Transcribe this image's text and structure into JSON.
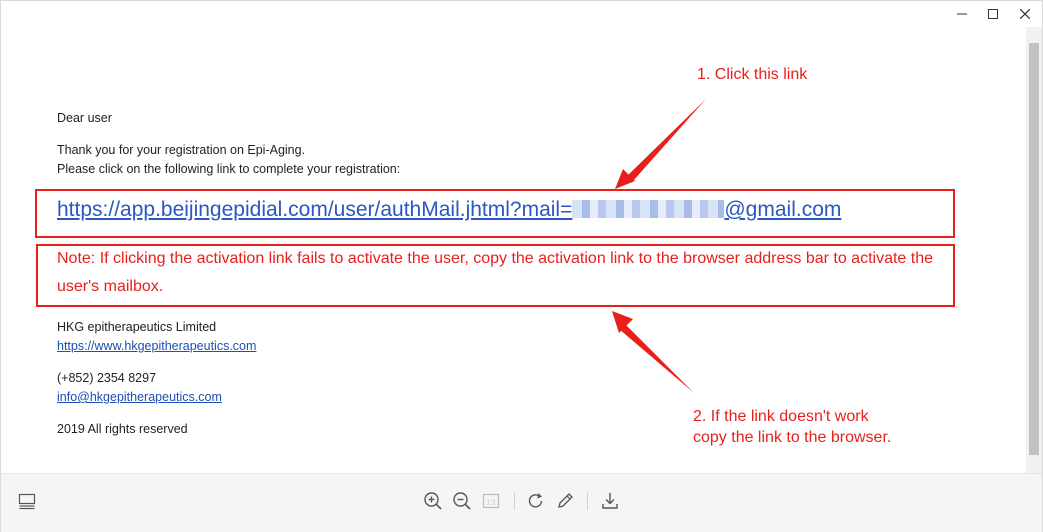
{
  "window": {
    "controls": [
      "minimize",
      "maximize",
      "close"
    ]
  },
  "email": {
    "greeting": "Dear user",
    "thanks": "Thank you for your registration on Epi-Aging.",
    "instruction": "Please click on the following link to complete your registration:",
    "activation_link_prefix": "https://app.beijingepidial.com/user/authMail.jhtml?mail=",
    "activation_link_suffix": "@gmail.com",
    "note": "Note: If clicking the activation link fails to activate the user, copy the activation link to the browser address bar to activate the user's mailbox.",
    "company_name": "HKG epitherapeutics Limited",
    "company_url": "https://www.hkgepitherapeutics.com",
    "phone": "(+852) 2354 8297",
    "email_address": "info@hkgepitherapeutics.com",
    "copyright": "2019 All rights reserved"
  },
  "annotations": {
    "step1": "1. Click this link",
    "step2_line1": "2. If the link doesn't work",
    "step2_line2": "copy the link to the browser."
  },
  "toolbar": {
    "page_indicator": "1:1"
  },
  "colors": {
    "annotation_red": "#e8201c",
    "link_blue": "#2a57c2"
  }
}
